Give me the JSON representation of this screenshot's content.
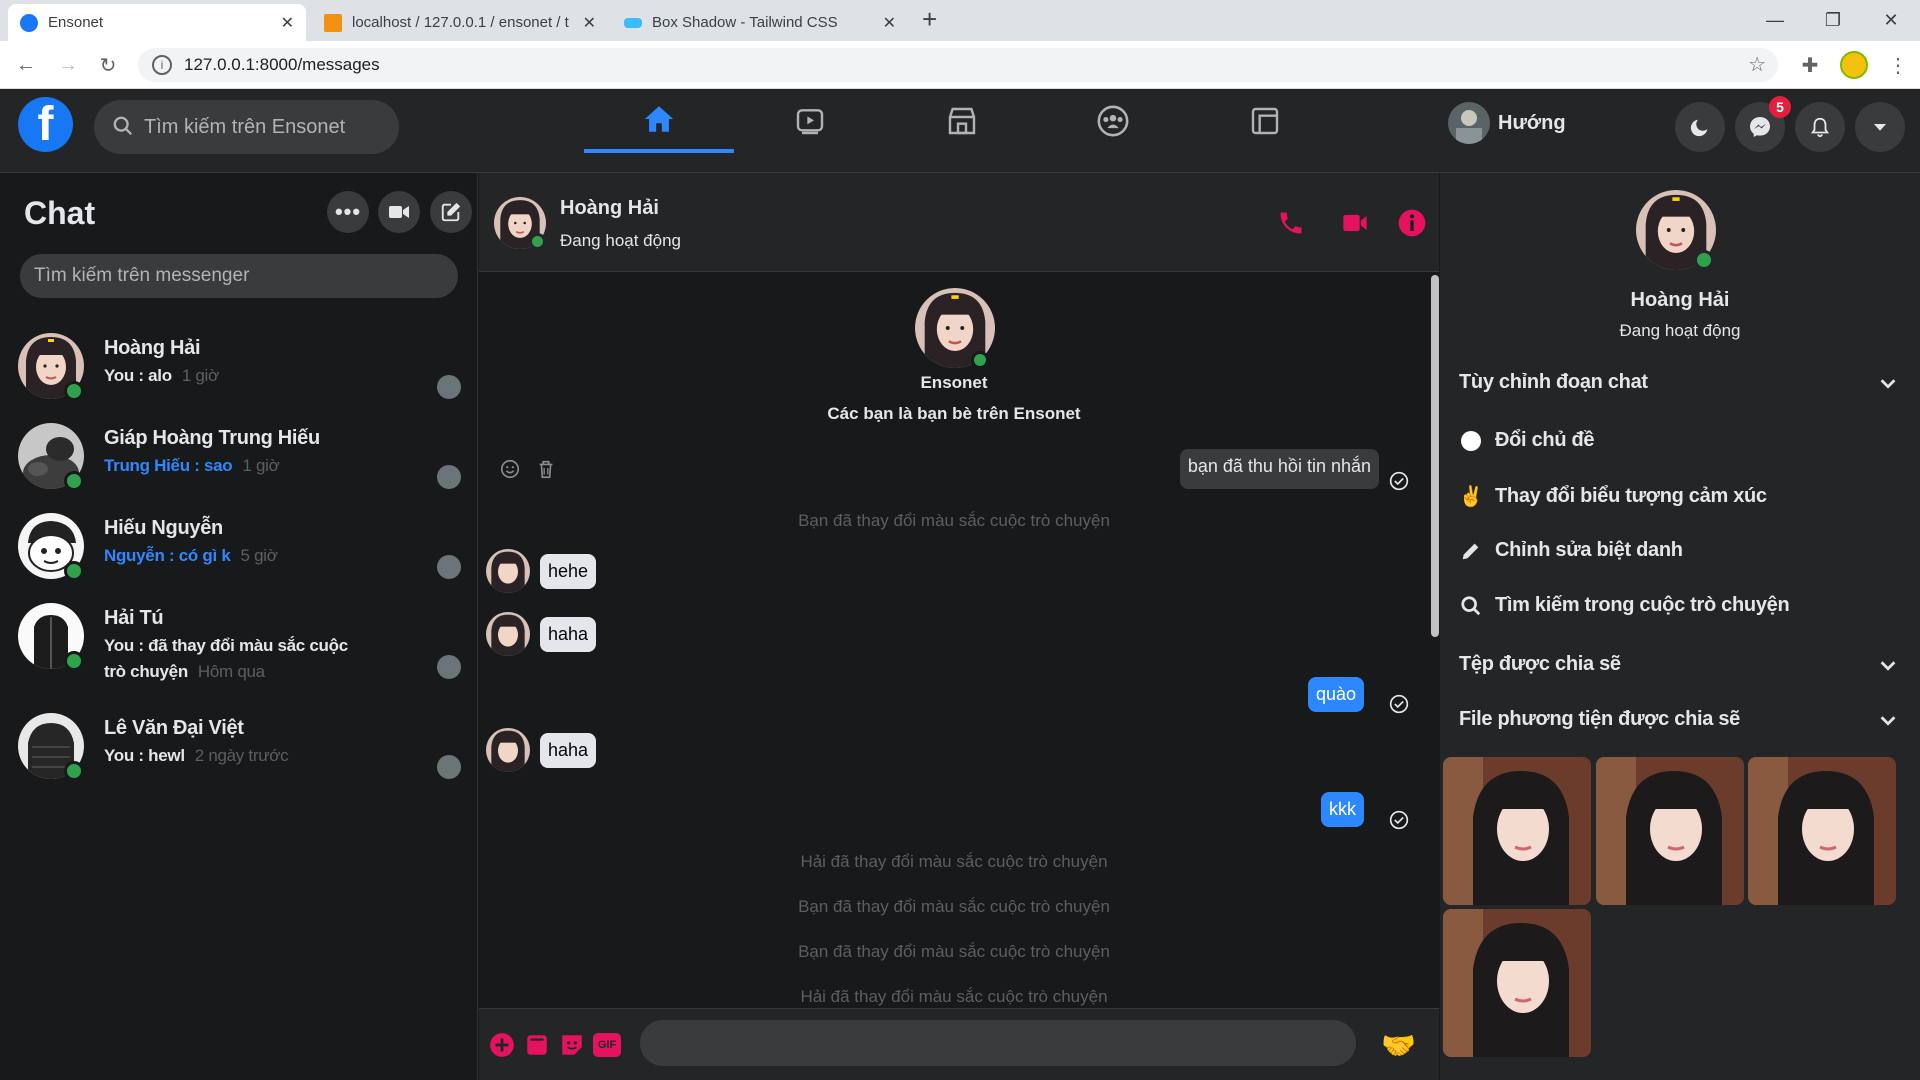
{
  "browser": {
    "tabs": [
      {
        "title": "Ensonet",
        "active": true
      },
      {
        "title": "localhost / 127.0.0.1 / ensonet / t",
        "active": false
      },
      {
        "title": "Box Shadow - Tailwind CSS",
        "active": false
      }
    ],
    "new_tab": "+",
    "url": "127.0.0.1:8000/messages"
  },
  "app": {
    "logo": "f",
    "search_placeholder": "Tìm kiếm trên Ensonet",
    "user_name": "Hướng",
    "messenger_badge": "5"
  },
  "sidebar": {
    "title": "Chat",
    "search_placeholder": "Tìm kiếm trên messenger",
    "conversations": [
      {
        "name": "Hoàng Hải",
        "preview": "You : alo",
        "time": "1 giờ",
        "highlight": false
      },
      {
        "name": "Giáp Hoàng Trung Hiếu",
        "preview": "Trung Hiếu : sao",
        "time": "1 giờ",
        "highlight": true
      },
      {
        "name": "Hiếu Nguyễn",
        "preview": "Nguyễn : có gì k",
        "time": "5 giờ",
        "highlight": true
      },
      {
        "name": "Hải Tú",
        "preview": "You : đã thay đổi màu sắc cuộc trò chuyện",
        "time": "Hôm qua",
        "highlight": false
      },
      {
        "name": "Lê Văn Đại Việt",
        "preview": "You : hewl",
        "time": "2 ngày trước",
        "highlight": false
      }
    ]
  },
  "chat": {
    "name": "Hoàng Hải",
    "status": "Đang hoạt động",
    "intro_title": "Ensonet",
    "intro_sub": "Các bạn là bạn bè trên Ensonet",
    "messages": {
      "recalled": "bạn đã thu hồi tin nhắn",
      "sys1": "Bạn đã thay đổi màu sắc cuộc trò chuyện",
      "in1": "hehe",
      "in2": "haha",
      "out1": "quào",
      "in3": "haha",
      "out2": "kkk",
      "sys2": "Hải đã thay đổi màu sắc cuộc trò chuyện",
      "sys3": "Bạn đã thay đổi màu sắc cuộc trò chuyện",
      "sys4": "Bạn đã thay đổi màu sắc cuộc trò chuyện",
      "sys5": "Hải đã thay đổi màu sắc cuộc trò chuyện"
    }
  },
  "info": {
    "name": "Hoàng Hải",
    "status": "Đang hoạt động",
    "customize": "Tùy chỉnh đoạn chat",
    "change_theme": "Đổi chủ đề",
    "change_emoji": "Thay đổi biểu tượng cảm xúc",
    "edit_nickname": "Chỉnh sửa biệt danh",
    "search_conv": "Tìm kiếm trong cuộc trò chuyện",
    "shared_files": "Tệp được chia sẽ",
    "shared_media": "File phương tiện được chia sẽ"
  },
  "colors": {
    "accent_pink": "#e4125f",
    "accent_blue": "#2d88ff",
    "online": "#31a24c"
  }
}
